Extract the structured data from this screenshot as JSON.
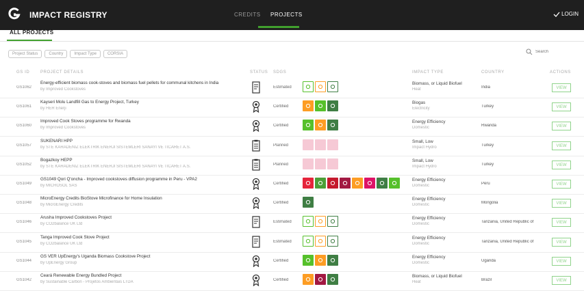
{
  "header": {
    "app_title": "IMPACT REGISTRY",
    "nav": [
      {
        "label": "CREDITS"
      },
      {
        "label": "PROJECTS"
      }
    ],
    "login_label": "LOGIN"
  },
  "subnav": {
    "tab_label": "ALL PROJECTS"
  },
  "filters": [
    "Project Status",
    "Country",
    "Impact Type",
    "CORSIA"
  ],
  "search": {
    "placeholder": "Search"
  },
  "table": {
    "headers": [
      "GS ID",
      "PROJECT DETAILS",
      "STATUS",
      "SDGS",
      "IMPACT TYPE",
      "COUNTRY",
      "ACTIONS"
    ],
    "view_label": "VIEW",
    "rows": [
      {
        "id": "GS1062",
        "name": "Energy-efficient biomass cook-stoves and biomass fuel pellets for communal kitchens in India",
        "developer": "by Improved Cookstoves",
        "status_icon": "document-icon",
        "status": "Estimated",
        "sdg_style": "outline",
        "sdgs": [
          "#56c02b",
          "#fd9d24",
          "#3f7e44"
        ],
        "impact_type": "Biomass, or Liquid Biofuel",
        "impact_sub": "Heat",
        "country": "India"
      },
      {
        "id": "GS1061",
        "name": "Kayseri Molu Landfill Gas to Energy Project, Turkey",
        "developer": "by HER Enerji",
        "status_icon": "award-icon",
        "status": "Certified",
        "sdg_style": "solid",
        "sdgs": [
          "#fd9d24",
          "#56c02b",
          "#3f7e44"
        ],
        "impact_type": "Biogas",
        "impact_sub": "Electricity",
        "country": "Turkey"
      },
      {
        "id": "GS1060",
        "name": "Improved Cook Stoves programme for Rwanda",
        "developer": "by Improved Cookstoves",
        "status_icon": "award-icon",
        "status": "Certified",
        "sdg_style": "solid",
        "sdgs": [
          "#56c02b",
          "#fd9d24",
          "#3f7e44"
        ],
        "impact_type": "Energy Efficiency",
        "impact_sub": "Domestic",
        "country": "Rwanda"
      },
      {
        "id": "GS1057",
        "name": "SUKENARI HPP",
        "developer": "by STE KARADENIZ ELEKTRIK ENERJI SISTEMLERI SANAYI VE TICARET A.S.",
        "status_icon": "clipboard-icon",
        "status": "Planned",
        "sdg_style": "faded",
        "sdgs": [
          "#f6c9d5",
          "#f6c9d5",
          "#f6c9d5"
        ],
        "impact_type": "Small, Low",
        "impact_sub": "Impact Hydro",
        "country": "Turkey"
      },
      {
        "id": "GS1052",
        "name": "Bogazkoy HEPP",
        "developer": "by STE KARADENIZ ELEKTRIK ENERJI SISTEMLERI SANAYI VE TICARET A.S.",
        "status_icon": "clipboard-icon",
        "status": "Planned",
        "sdg_style": "faded",
        "sdgs": [
          "#f6c9d5",
          "#f6c9d5",
          "#f6c9d5"
        ],
        "impact_type": "Small, Low",
        "impact_sub": "Impact Hydro",
        "country": "Turkey"
      },
      {
        "id": "GS1049",
        "name": "GS1049 Qori Q'oncha - Improved cookstoves diffusion programme in Peru - VPA2",
        "developer": "by MICROSOL SAS",
        "status_icon": "award-icon",
        "status": "Certified",
        "sdg_style": "solid",
        "sdgs": [
          "#e5243b",
          "#4c9f38",
          "#c5192d",
          "#a21942",
          "#fd9d24",
          "#dd1367",
          "#3f7e44",
          "#56c02b"
        ],
        "impact_type": "Energy Efficiency",
        "impact_sub": "Domestic",
        "country": "Peru"
      },
      {
        "id": "GS1048",
        "name": "MicroEnergy Credits BioStove Microfinance for Home Insulation",
        "developer": "by MicroEnergy Credits",
        "status_icon": "award-icon",
        "status": "Certified",
        "sdg_style": "solid",
        "sdgs": [
          "#3f7e44"
        ],
        "impact_type": "Energy Efficiency",
        "impact_sub": "Domestic",
        "country": "Mongolia"
      },
      {
        "id": "GS1046",
        "name": "Arusha Improved Cookstoves Project",
        "developer": "by CO2balance UK Ltd",
        "status_icon": "document-icon",
        "status": "Estimated",
        "sdg_style": "outline",
        "sdgs": [
          "#56c02b",
          "#fd9d24",
          "#3f7e44"
        ],
        "impact_type": "Energy Efficiency",
        "impact_sub": "Domestic",
        "country": "Tanzania, United Republic of"
      },
      {
        "id": "GS1045",
        "name": "Tanga Improved Cook Stove Project",
        "developer": "by CO2balance UK Ltd",
        "status_icon": "document-icon",
        "status": "Estimated",
        "sdg_style": "outline",
        "sdgs": [
          "#56c02b",
          "#fd9d24",
          "#3f7e44"
        ],
        "impact_type": "Energy Efficiency",
        "impact_sub": "Domestic",
        "country": "Tanzania, United Republic of"
      },
      {
        "id": "GS1044",
        "name": "GS VER UpEnergy's Uganda Biomass Cookstove Project",
        "developer": "by UpEnergy Group",
        "status_icon": "award-icon",
        "status": "Certified",
        "sdg_style": "solid",
        "sdgs": [
          "#56c02b",
          "#fd9d24",
          "#3f7e44"
        ],
        "impact_type": "Energy Efficiency",
        "impact_sub": "Domestic",
        "country": "Uganda"
      },
      {
        "id": "GS1042",
        "name": "Ceará Renewable Energy Bundled Project",
        "developer": "by Sustainable Carbon - Projetos Ambientais LTDA",
        "status_icon": "award-icon",
        "status": "Certified",
        "sdg_style": "solid",
        "sdgs": [
          "#fd9d24",
          "#a21942",
          "#3f7e44"
        ],
        "impact_type": "Biomass, or Liquid Biofuel",
        "impact_sub": "Heat",
        "country": "Brazil"
      }
    ]
  }
}
